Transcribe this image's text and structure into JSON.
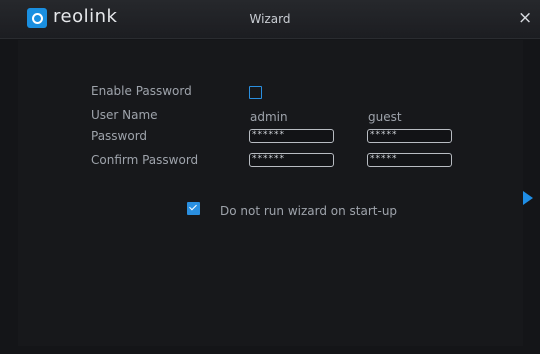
{
  "header": {
    "brand": "reolink",
    "title": "Wizard",
    "close": "×"
  },
  "form": {
    "enable_password_label": "Enable Password",
    "enable_password_checked": false,
    "user_name_label": "User Name",
    "password_label": "Password",
    "confirm_password_label": "Confirm Password",
    "users": [
      {
        "name": "admin",
        "password": "******",
        "confirm": "******"
      },
      {
        "name": "guest",
        "password": "*****",
        "confirm": "*****"
      }
    ]
  },
  "startup": {
    "checked": true,
    "label": "Do not run wizard on start-up"
  },
  "colors": {
    "accent": "#1f8ee6",
    "background": "#141518"
  },
  "icons": {
    "logo": "reolink-logo-icon",
    "close": "close-icon",
    "next": "next-arrow-icon"
  }
}
